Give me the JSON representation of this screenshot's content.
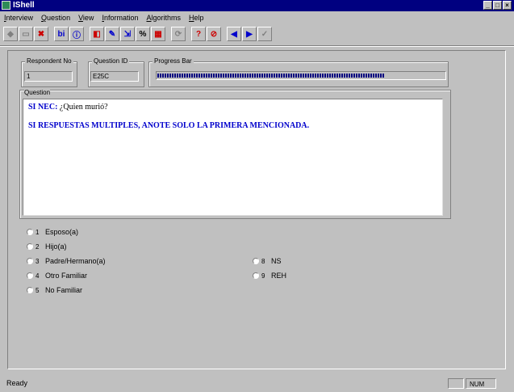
{
  "window": {
    "title": "IShell"
  },
  "menu": [
    "Interview",
    "Question",
    "View",
    "Information",
    "Algorithms",
    "Help"
  ],
  "toolbar": [
    {
      "name": "back-icon",
      "glyph": "◆",
      "color": "#808080"
    },
    {
      "name": "page-icon",
      "glyph": "▭",
      "color": "#808080"
    },
    {
      "name": "delete-icon",
      "glyph": "✖",
      "color": "#cc0000"
    },
    {
      "name": "bi-icon",
      "glyph": "bi",
      "color": "#0000cc"
    },
    {
      "name": "info-icon",
      "glyph": "ⓘ",
      "color": "#0000cc"
    },
    {
      "name": "record-icon",
      "glyph": "◧",
      "color": "#cc0000"
    },
    {
      "name": "edit-icon",
      "glyph": "✎",
      "color": "#0000cc"
    },
    {
      "name": "export-icon",
      "glyph": "⇲",
      "color": "#0000cc"
    },
    {
      "name": "percent-icon",
      "glyph": "%",
      "color": "#000000"
    },
    {
      "name": "colors-icon",
      "glyph": "▦",
      "color": "#cc0000"
    },
    {
      "name": "refresh-icon",
      "glyph": "⟳",
      "color": "#808080"
    },
    {
      "name": "help-icon",
      "glyph": "?",
      "color": "#cc0000"
    },
    {
      "name": "eraser-icon",
      "glyph": "⊘",
      "color": "#cc0000"
    },
    {
      "name": "prev-icon",
      "glyph": "◀",
      "color": "#0000cc"
    },
    {
      "name": "next-icon",
      "glyph": "▶",
      "color": "#0000cc"
    },
    {
      "name": "check-icon",
      "glyph": "✓",
      "color": "#808080"
    }
  ],
  "fields": {
    "respondent_label": "Respondent No",
    "respondent_value": "1",
    "question_id_label": "Question ID",
    "question_id_value": "E25C",
    "progress_label": "Progress Bar",
    "progress_fraction": 0.79
  },
  "question": {
    "label": "Question",
    "lead": "SI NEC:",
    "text": " ¿Quien murió?",
    "instruction": "SI RESPUESTAS MULTIPLES, ANOTE SOLO LA PRIMERA MENCIONADA."
  },
  "options_left": [
    {
      "num": "1",
      "label": "Esposo(a)"
    },
    {
      "num": "2",
      "label": "Hijo(a)"
    },
    {
      "num": "3",
      "label": "Padre/Hermano(a)"
    },
    {
      "num": "4",
      "label": "Otro Familiar"
    },
    {
      "num": "5",
      "label": "No Familiar"
    }
  ],
  "options_right": [
    {
      "num": "8",
      "label": "NS"
    },
    {
      "num": "9",
      "label": "REH"
    }
  ],
  "status": {
    "text": "Ready",
    "num": "NUM"
  }
}
